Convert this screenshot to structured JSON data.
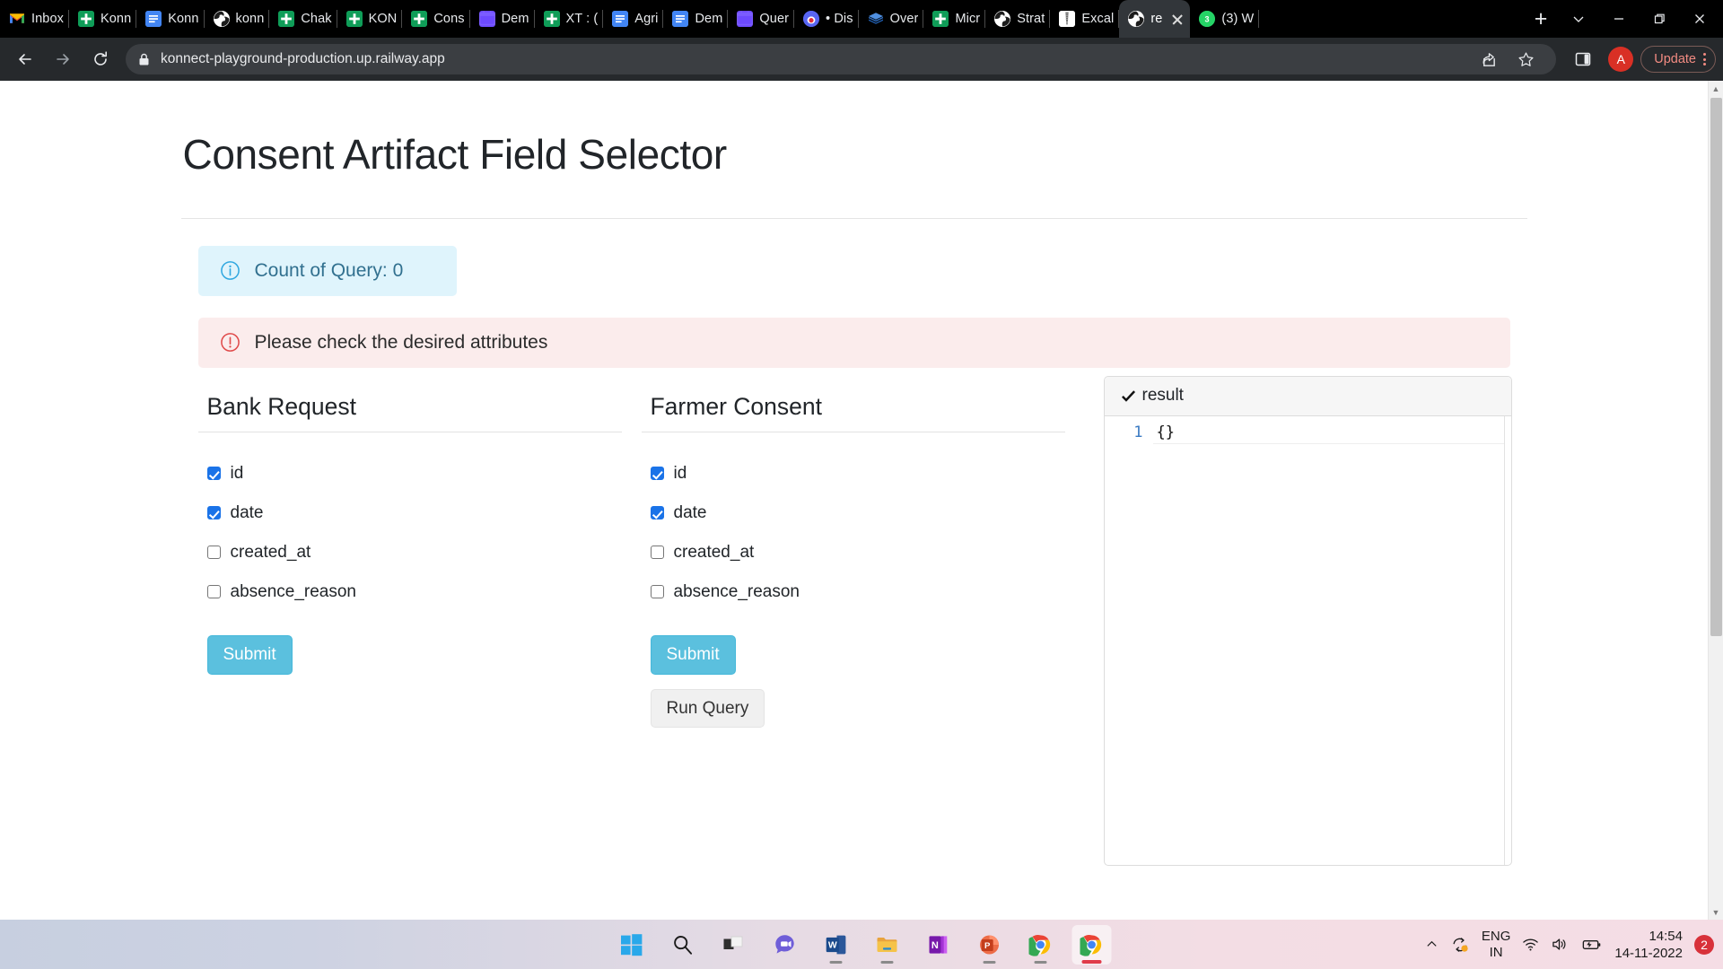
{
  "browser": {
    "tabs": [
      {
        "title": "Inbox",
        "icon": "gmail-icon",
        "favclass": "fav-gmail",
        "active": false
      },
      {
        "title": "Konn",
        "icon": "google-sheets-icon",
        "favclass": "fav-sheets",
        "active": false
      },
      {
        "title": "Konn",
        "icon": "google-docs-icon",
        "favclass": "fav-docs",
        "active": false
      },
      {
        "title": "konn",
        "icon": "globe-icon",
        "favclass": "fav-chrome-globe",
        "active": false
      },
      {
        "title": "Chak",
        "icon": "google-sheets-icon",
        "favclass": "fav-sheets",
        "active": false
      },
      {
        "title": "KON",
        "icon": "google-sheets-icon",
        "favclass": "fav-sheets",
        "active": false
      },
      {
        "title": "Cons",
        "icon": "google-sheets-icon",
        "favclass": "fav-sheets",
        "active": false
      },
      {
        "title": "Dem",
        "icon": "thunder-client-icon",
        "favclass": "fav-thunder",
        "active": false
      },
      {
        "title": "XT : (",
        "icon": "google-sheets-icon",
        "favclass": "fav-sheets",
        "active": false
      },
      {
        "title": "Agri",
        "icon": "google-docs-icon",
        "favclass": "fav-docs",
        "active": false
      },
      {
        "title": "Dem",
        "icon": "google-docs-icon",
        "favclass": "fav-docs",
        "active": false
      },
      {
        "title": "Quer",
        "icon": "thunder-client-icon",
        "favclass": "fav-thunder",
        "active": false
      },
      {
        "title": "• Dis",
        "icon": "discord-icon",
        "favclass": "fav-discord",
        "active": false
      },
      {
        "title": "Over",
        "icon": "overleaf-icon",
        "favclass": "fav-overleaf",
        "active": false
      },
      {
        "title": "Micr",
        "icon": "google-sheets-icon",
        "favclass": "fav-sheets",
        "active": false
      },
      {
        "title": "Strat",
        "icon": "globe-icon",
        "favclass": "fav-chrome-globe",
        "active": false
      },
      {
        "title": "Excal",
        "icon": "excalidraw-icon",
        "favclass": "fav-excal",
        "active": false
      },
      {
        "title": "re",
        "icon": "globe-icon",
        "favclass": "fav-chrome-globe",
        "active": true
      },
      {
        "title": "(3) W",
        "icon": "whatsapp-icon",
        "favclass": "fav-whats",
        "badge": "3",
        "active": false
      }
    ],
    "new_tab_label": "+",
    "window_controls": {
      "tab_search": "tab-search",
      "minimize": "minimize",
      "restore": "restore",
      "close": "close"
    },
    "toolbar": {
      "back": "back",
      "forward": "forward",
      "reload": "reload",
      "lock": "site-secure",
      "url": "konnect-playground-production.up.railway.app",
      "share": "share",
      "bookmark": "bookmark",
      "side_panel": "side-panel",
      "profile_initial": "A",
      "update_label": "Update"
    }
  },
  "app": {
    "title": "Consent Artifact Field Selector",
    "info_alert": {
      "icon": "info-circle-icon",
      "text": "Count of Query: 0"
    },
    "error_alert": {
      "icon": "exclamation-circle-icon",
      "text": "Please check the desired attributes"
    },
    "columns": [
      {
        "heading": "Bank Request",
        "fields": [
          {
            "label": "id",
            "checked": true
          },
          {
            "label": "date",
            "checked": true
          },
          {
            "label": "created_at",
            "checked": false
          },
          {
            "label": "absence_reason",
            "checked": false
          }
        ],
        "submit_label": "Submit",
        "run_query_label": null
      },
      {
        "heading": "Farmer Consent",
        "fields": [
          {
            "label": "id",
            "checked": true
          },
          {
            "label": "date",
            "checked": true
          },
          {
            "label": "created_at",
            "checked": false
          },
          {
            "label": "absence_reason",
            "checked": false
          }
        ],
        "submit_label": "Submit",
        "run_query_label": "Run Query"
      }
    ],
    "result_panel": {
      "icon": "check-mark-icon",
      "title": "result",
      "line_number": "1",
      "content": "{}"
    },
    "colors": {
      "info_bg": "#dff4fc",
      "info_accent": "#31a8e0",
      "danger_bg": "#fbecec",
      "danger_accent": "#e04a4a",
      "submit_bg": "#5bc0de",
      "checkbox_checked": "#1a73e8"
    }
  },
  "taskbar": {
    "items": [
      {
        "name": "start-button",
        "icon": "windows-logo-icon",
        "running": false
      },
      {
        "name": "search-button",
        "icon": "search-icon",
        "running": false
      },
      {
        "name": "task-view-button",
        "icon": "task-view-icon",
        "running": false
      },
      {
        "name": "teams-button",
        "icon": "teams-icon",
        "running": false
      },
      {
        "name": "word-button",
        "icon": "word-icon",
        "running": true
      },
      {
        "name": "file-explorer-button",
        "icon": "folder-icon",
        "running": true
      },
      {
        "name": "onenote-button",
        "icon": "onenote-icon",
        "running": false
      },
      {
        "name": "powerpoint-button",
        "icon": "powerpoint-icon",
        "running": true
      },
      {
        "name": "chrome-button",
        "icon": "chrome-icon",
        "running": true
      },
      {
        "name": "chrome-active-button",
        "icon": "chrome-icon",
        "running": true,
        "active": true
      }
    ],
    "tray": {
      "overflow": "show-hidden-icons",
      "sync_icon": "sync-icon",
      "language_line1": "ENG",
      "language_line2": "IN",
      "wifi_icon": "wifi-icon",
      "volume_icon": "volume-icon",
      "battery_icon": "battery-charging-icon",
      "time": "14:54",
      "date": "14-11-2022",
      "notification_count": "2"
    }
  }
}
